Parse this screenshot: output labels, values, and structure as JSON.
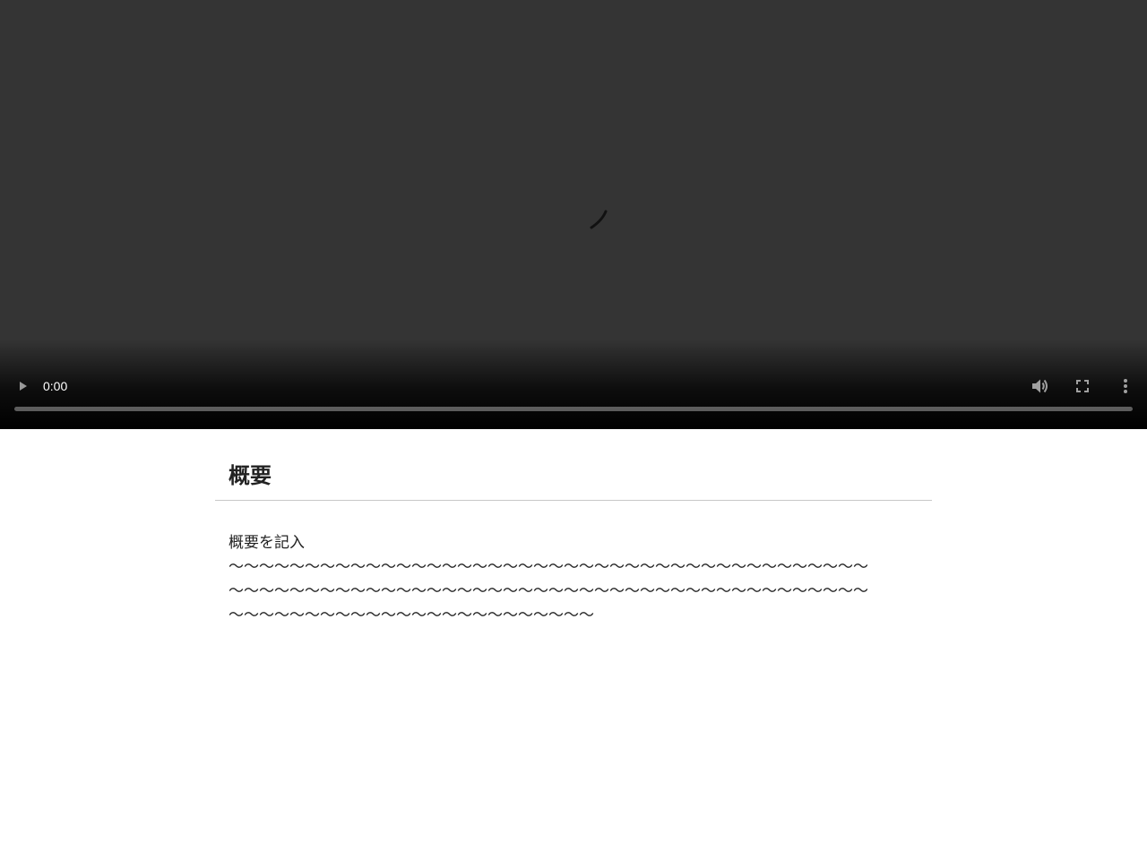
{
  "video": {
    "current_time": "0:00",
    "progress_fraction": 0,
    "play_icon": "play-icon",
    "volume_icon": "volume-icon",
    "fullscreen_icon": "fullscreen-icon",
    "more_icon": "more-options-icon",
    "spinner_icon": "loading-spinner-icon"
  },
  "section": {
    "title": "概要",
    "description": [
      "概要を記入",
      "〜〜〜〜〜〜〜〜〜〜〜〜〜〜〜〜〜〜〜〜〜〜〜〜〜〜〜〜〜〜〜〜〜〜〜〜〜〜〜〜〜〜",
      "〜〜〜〜〜〜〜〜〜〜〜〜〜〜〜〜〜〜〜〜〜〜〜〜〜〜〜〜〜〜〜〜〜〜〜〜〜〜〜〜〜〜",
      "〜〜〜〜〜〜〜〜〜〜〜〜〜〜〜〜〜〜〜〜〜〜〜〜"
    ]
  },
  "colors": {
    "player_bg": "#343434",
    "text": "#222222",
    "divider": "#c8c8c8"
  }
}
